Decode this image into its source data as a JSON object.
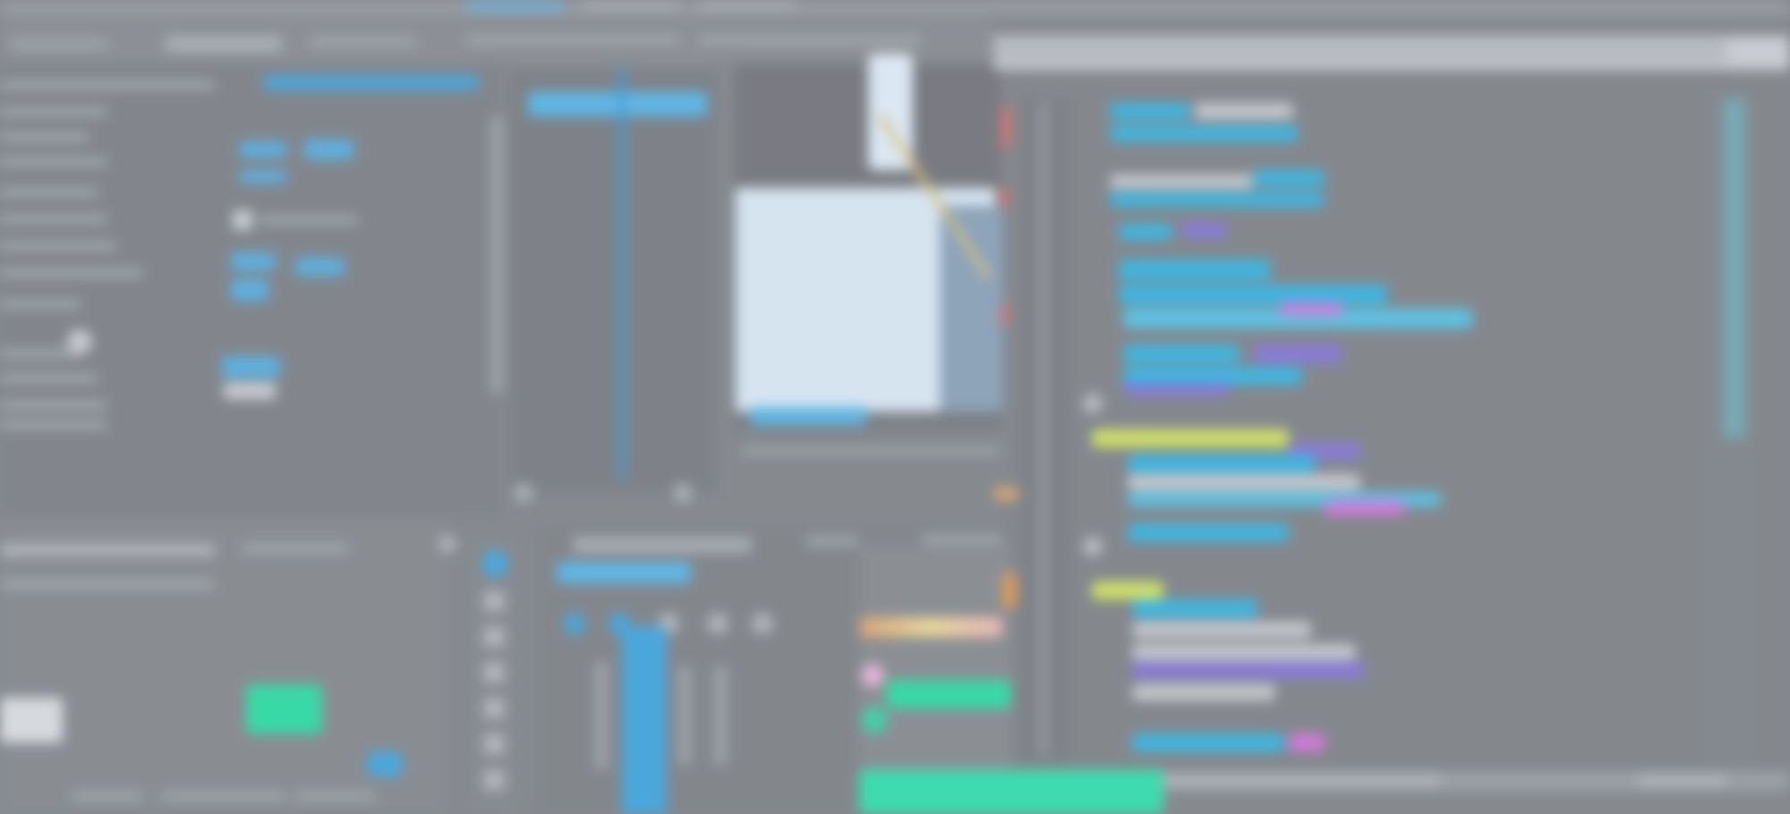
{
  "window": {
    "title": "",
    "status_text": "",
    "caption": ""
  },
  "menu": {
    "items": [
      "",
      "",
      "",
      "",
      "",
      "",
      "",
      ""
    ]
  },
  "panels": {
    "properties": {
      "rows": [
        "",
        "",
        "",
        "",
        "",
        "",
        "",
        "",
        "",
        "",
        "",
        "",
        ""
      ]
    },
    "preview": {
      "caption": ""
    },
    "timeline": {
      "tabs": [
        "",
        "",
        ""
      ],
      "track_label": ""
    },
    "code": {
      "tab_label": ""
    }
  },
  "colors": {
    "background": "#868a8f",
    "panel_dark": "#7b7f85",
    "accent_blue": "#4aa7dc",
    "accent_green": "#39d9a6",
    "code_bg": "#8a8d92",
    "syntax_cyan": "#3fb6e0",
    "syntax_purple": "#8a7ad8",
    "syntax_yellow": "#d0e06a",
    "syntax_pink": "#d27ad8"
  },
  "icons": [
    "play-icon",
    "pause-icon",
    "cursor-icon",
    "scissor-icon",
    "magnet-icon",
    "gear-icon"
  ]
}
